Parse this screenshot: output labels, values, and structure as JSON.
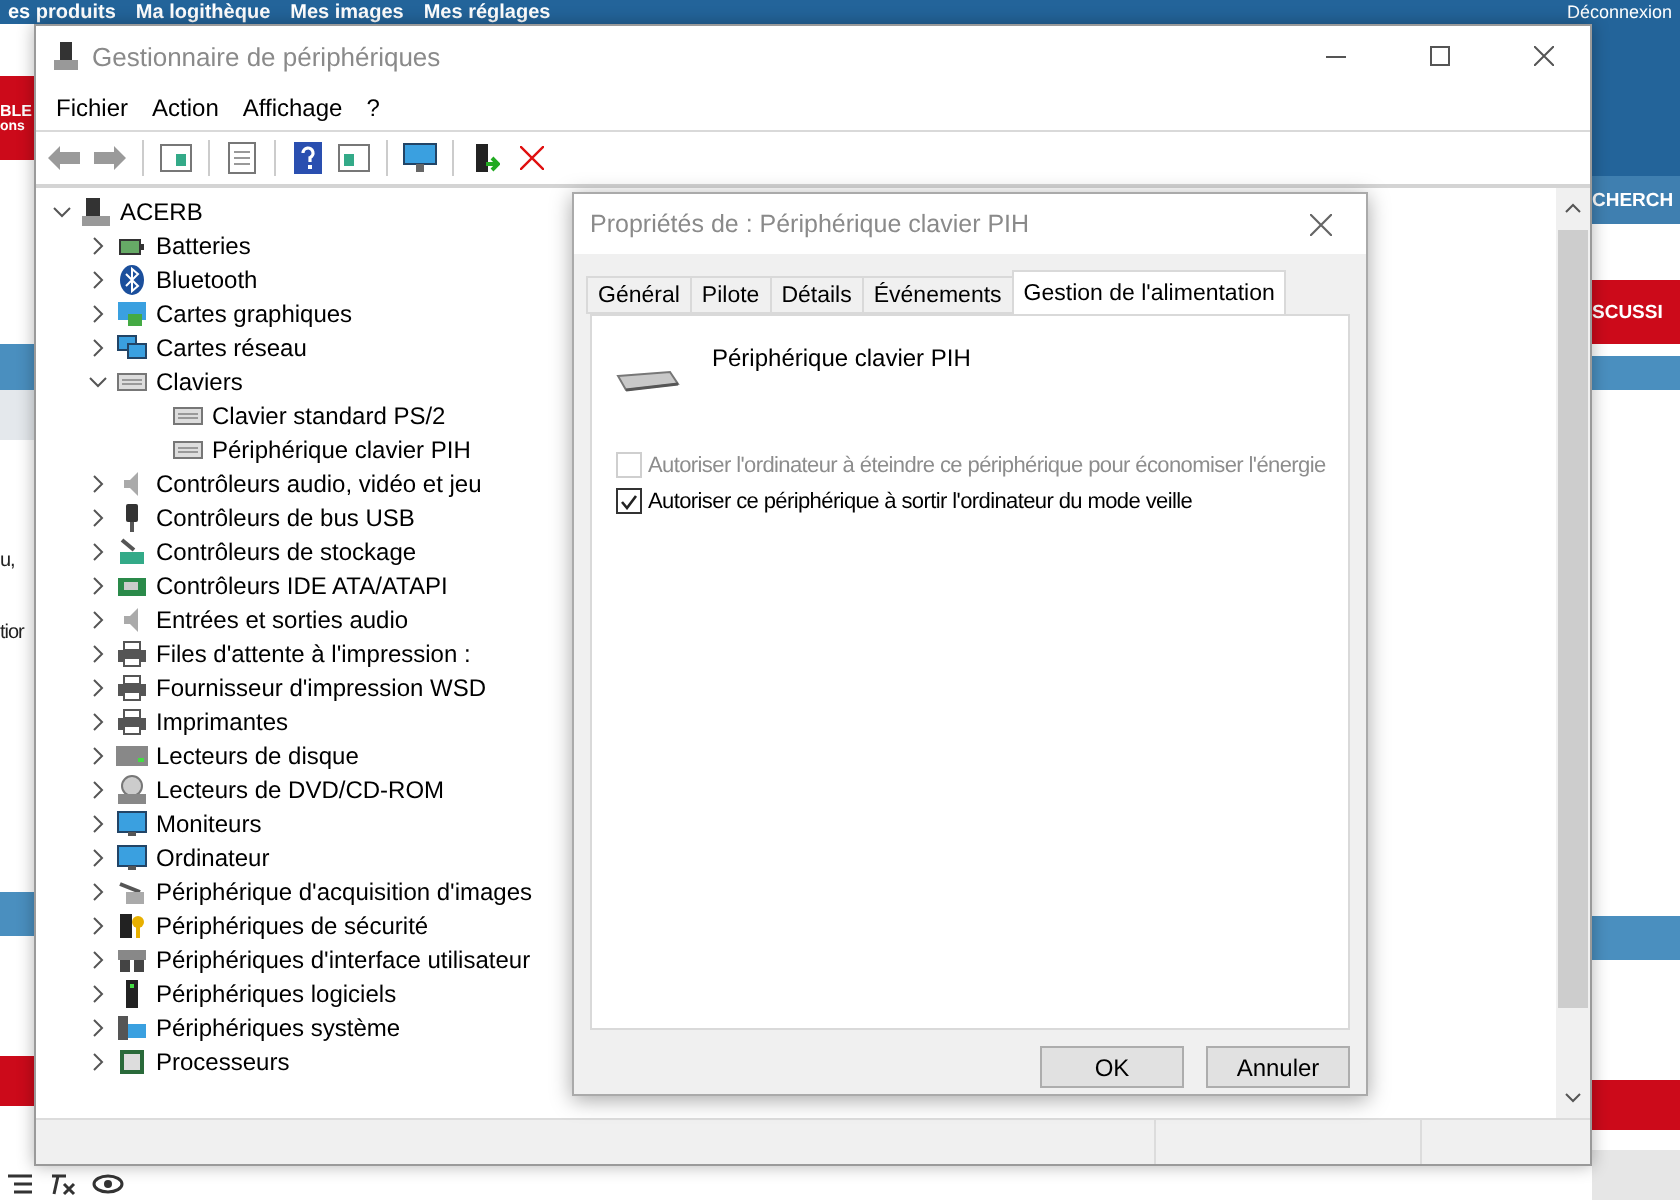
{
  "background_page": {
    "nav_links": [
      "es produits",
      "Ma logithèque",
      "Mes images",
      "Mes réglages"
    ],
    "logout": "Déconnexion",
    "left_banner": [
      "BLE",
      "ons"
    ],
    "left_text": [
      "u,",
      "tior"
    ],
    "right_fragments": [
      "CHERCH",
      "SCUSSI"
    ]
  },
  "window": {
    "title": "Gestionnaire de périphériques"
  },
  "menu": [
    "Fichier",
    "Action",
    "Affichage",
    "?"
  ],
  "tree": {
    "label": "ACERB",
    "expanded": true,
    "children": [
      {
        "label": "Batteries",
        "expanded": false
      },
      {
        "label": "Bluetooth",
        "expanded": false
      },
      {
        "label": "Cartes graphiques",
        "expanded": false
      },
      {
        "label": "Cartes réseau",
        "expanded": false
      },
      {
        "label": "Claviers",
        "expanded": true,
        "children": [
          {
            "label": "Clavier standard PS/2"
          },
          {
            "label": "Périphérique clavier PIH"
          }
        ]
      },
      {
        "label": "Contrôleurs audio, vidéo et jeu",
        "expanded": false
      },
      {
        "label": "Contrôleurs de bus USB",
        "expanded": false
      },
      {
        "label": "Contrôleurs de stockage",
        "expanded": false
      },
      {
        "label": "Contrôleurs IDE ATA/ATAPI",
        "expanded": false
      },
      {
        "label": "Entrées et sorties audio",
        "expanded": false
      },
      {
        "label": "Files d'attente à l'impression :",
        "expanded": false
      },
      {
        "label": "Fournisseur d'impression WSD",
        "expanded": false
      },
      {
        "label": "Imprimantes",
        "expanded": false
      },
      {
        "label": "Lecteurs de disque",
        "expanded": false
      },
      {
        "label": "Lecteurs de DVD/CD-ROM",
        "expanded": false
      },
      {
        "label": "Moniteurs",
        "expanded": false
      },
      {
        "label": "Ordinateur",
        "expanded": false
      },
      {
        "label": "Périphérique d'acquisition d'images",
        "expanded": false
      },
      {
        "label": "Périphériques de sécurité",
        "expanded": false
      },
      {
        "label": "Périphériques d'interface utilisateur",
        "expanded": false
      },
      {
        "label": "Périphériques logiciels",
        "expanded": false
      },
      {
        "label": "Périphériques système",
        "expanded": false
      },
      {
        "label": "Processeurs",
        "expanded": false
      }
    ]
  },
  "dialog": {
    "title": "Propriétés de : Périphérique clavier PIH",
    "tabs": [
      {
        "label": "Général",
        "selected": false
      },
      {
        "label": "Pilote",
        "selected": false
      },
      {
        "label": "Détails",
        "selected": false
      },
      {
        "label": "Événements",
        "selected": false
      },
      {
        "label": "Gestion de l'alimentation",
        "selected": true
      }
    ],
    "device_name": "Périphérique clavier PIH",
    "options": [
      {
        "label": "Autoriser l'ordinateur à éteindre ce périphérique pour économiser l'énergie",
        "checked": false,
        "disabled": true
      },
      {
        "label": "Autoriser ce périphérique à sortir l'ordinateur du mode veille",
        "checked": true,
        "disabled": false
      }
    ],
    "buttons": [
      "OK",
      "Annuler"
    ]
  }
}
